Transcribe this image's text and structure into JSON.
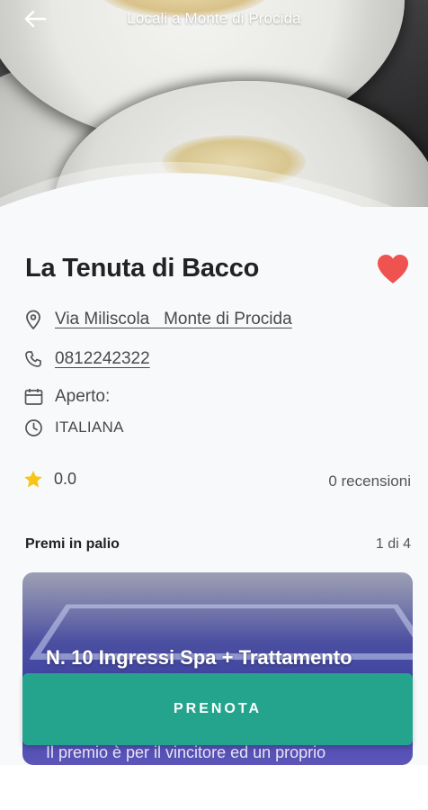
{
  "header": {
    "title": "Locali a Monte di Procida",
    "back_icon": "arrow-left-icon"
  },
  "venue": {
    "name": "La Tenuta di Bacco",
    "favorite": true,
    "favorite_color": "#ef5350",
    "address": "Via Miliscola   Monte di Procida",
    "phone": "0812242322",
    "hours_label": "Aperto:",
    "cuisine": "ITALIANA"
  },
  "rating": {
    "value": "0.0",
    "reviews": "0 recensioni",
    "star_color": "#f5c518"
  },
  "prizes": {
    "title": "Premi in palio",
    "counter": "1 di 4",
    "items": [
      {
        "name": "N. 10 Ingressi Spa + Trattamento",
        "description": "Il premio è per il vincitore ed un proprio"
      }
    ]
  },
  "actions": {
    "book_label": "PRENOTA",
    "book_color": "#24a48d"
  }
}
